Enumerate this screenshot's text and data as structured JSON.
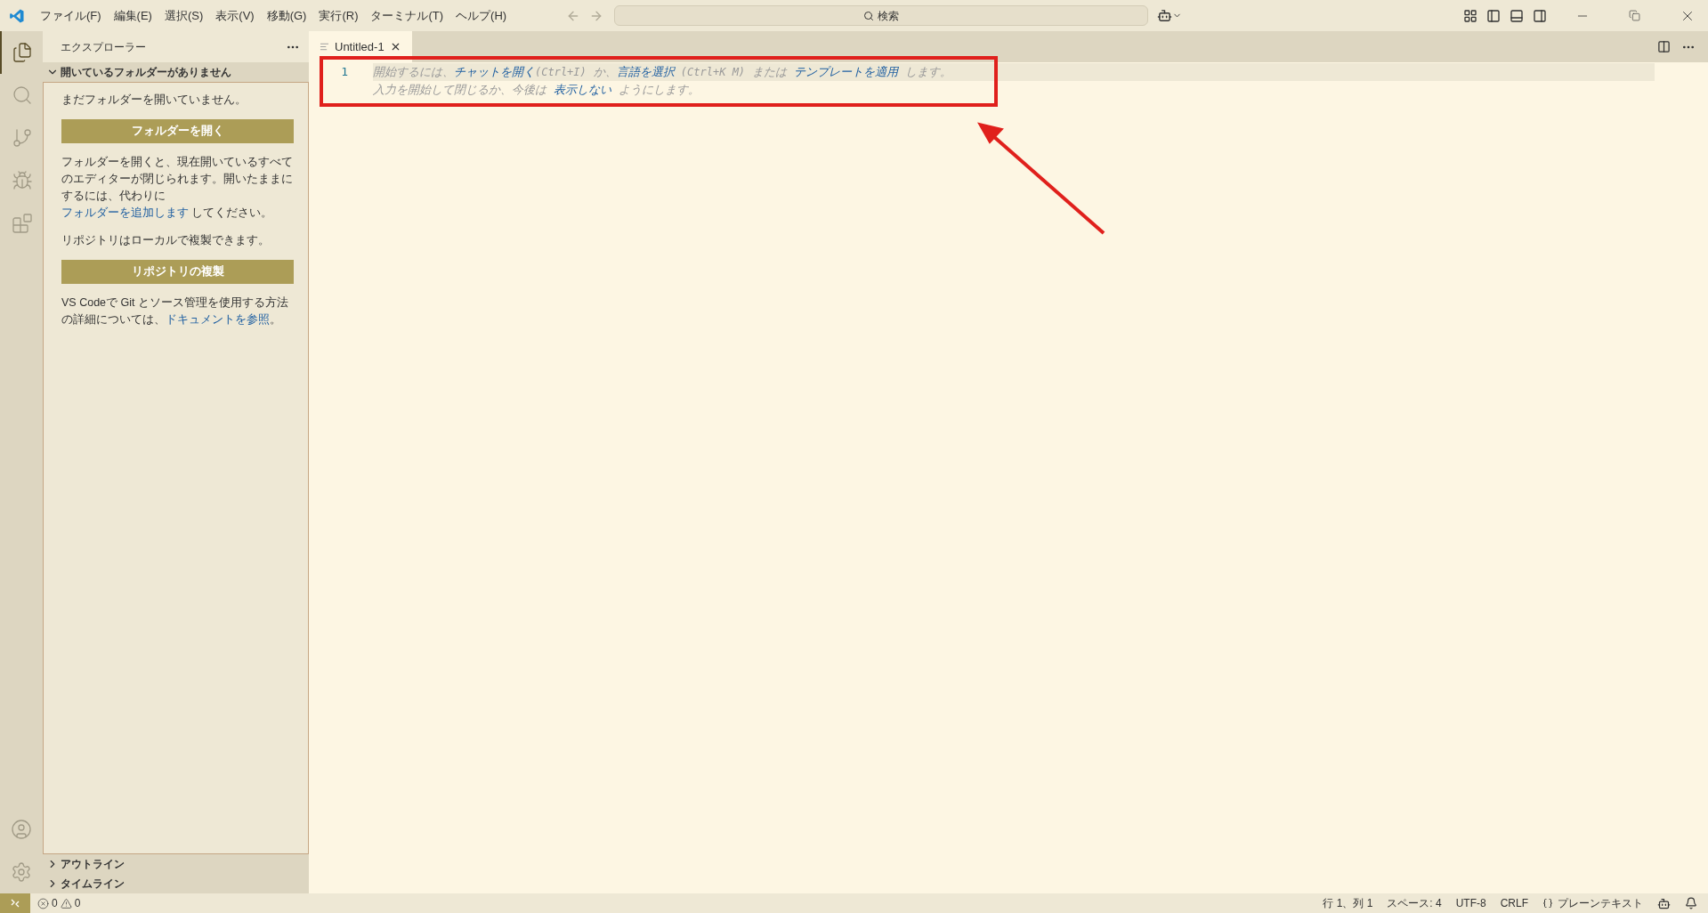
{
  "menu_bar": {
    "items": [
      "ファイル(F)",
      "編集(E)",
      "選択(S)",
      "表示(V)",
      "移動(G)",
      "実行(R)",
      "ターミナル(T)",
      "ヘルプ(H)"
    ]
  },
  "search": {
    "label": "検索"
  },
  "activity_bar": {
    "items": [
      {
        "kind": "explorer",
        "selected": true
      },
      {
        "kind": "search",
        "selected": false
      },
      {
        "kind": "source_control",
        "selected": false
      },
      {
        "kind": "run",
        "selected": false
      },
      {
        "kind": "extensions",
        "selected": false
      }
    ],
    "bottom": [
      {
        "kind": "account"
      },
      {
        "kind": "settings"
      }
    ]
  },
  "sidebar": {
    "title": "エクスプローラー",
    "section": {
      "title": "開いているフォルダーがありません",
      "expanded": true
    },
    "content": [
      {
        "kind": "text",
        "parts": [
          {
            "kind": "text",
            "text": "まだフォルダーを開いていません。"
          }
        ]
      },
      {
        "kind": "button",
        "label": "フォルダーを開く"
      },
      {
        "kind": "text",
        "parts": [
          {
            "kind": "text",
            "text": "フォルダーを開くと、現在開いているすべてのエディターが閉じられます。開いたままにするには、代わりに "
          },
          {
            "kind": "link",
            "text": "フォルダーを追加します"
          },
          {
            "kind": "text",
            "text": " してください。"
          }
        ]
      },
      {
        "kind": "text",
        "parts": [
          {
            "kind": "text",
            "text": "リポジトリはローカルで複製できます。"
          }
        ]
      },
      {
        "kind": "button",
        "label": "リポジトリの複製"
      },
      {
        "kind": "text",
        "parts": [
          {
            "kind": "text",
            "text": "VS Codeで Git とソース管理を使用する方法の詳細については、"
          },
          {
            "kind": "link",
            "text": "ドキュメントを参照"
          },
          {
            "kind": "text",
            "text": "。"
          }
        ]
      }
    ],
    "collapsed_sections": [
      {
        "title": "アウトライン",
        "expanded": false
      },
      {
        "title": "タイムライン",
        "expanded": false
      }
    ]
  },
  "tabs": [
    {
      "label": "Untitled-1",
      "selected": true
    }
  ],
  "editor": {
    "line_numbers": [
      "1"
    ],
    "hint_lines": [
      [
        {
          "kind": "text",
          "text": "開始するには、"
        },
        {
          "kind": "link",
          "text": "チャットを開く"
        },
        {
          "kind": "key",
          "text": "(Ctrl+I)"
        },
        {
          "kind": "text",
          "text": " か、"
        },
        {
          "kind": "link",
          "text": "言語を選択"
        },
        {
          "kind": "key",
          "text": " (Ctrl+K M)"
        },
        {
          "kind": "text",
          "text": " または "
        },
        {
          "kind": "link",
          "text": "テンプレートを適用"
        },
        {
          "kind": "text",
          "text": " します。"
        }
      ],
      [
        {
          "kind": "text",
          "text": "入力を開始して閉じるか、今後は "
        },
        {
          "kind": "link",
          "text": "表示しない"
        },
        {
          "kind": "text",
          "text": " ようにします。"
        }
      ]
    ]
  },
  "annotation": {
    "kind": "box_with_arrow"
  },
  "status_bar": {
    "errors": "0",
    "warnings": "0",
    "items": [
      {
        "kind": "text",
        "text": "行 1、列 1"
      },
      {
        "kind": "text",
        "text": "スペース: 4"
      },
      {
        "kind": "text",
        "text": "UTF-8"
      },
      {
        "kind": "text",
        "text": "CRLF"
      },
      {
        "kind": "language",
        "text": "プレーンテキスト"
      }
    ]
  }
}
